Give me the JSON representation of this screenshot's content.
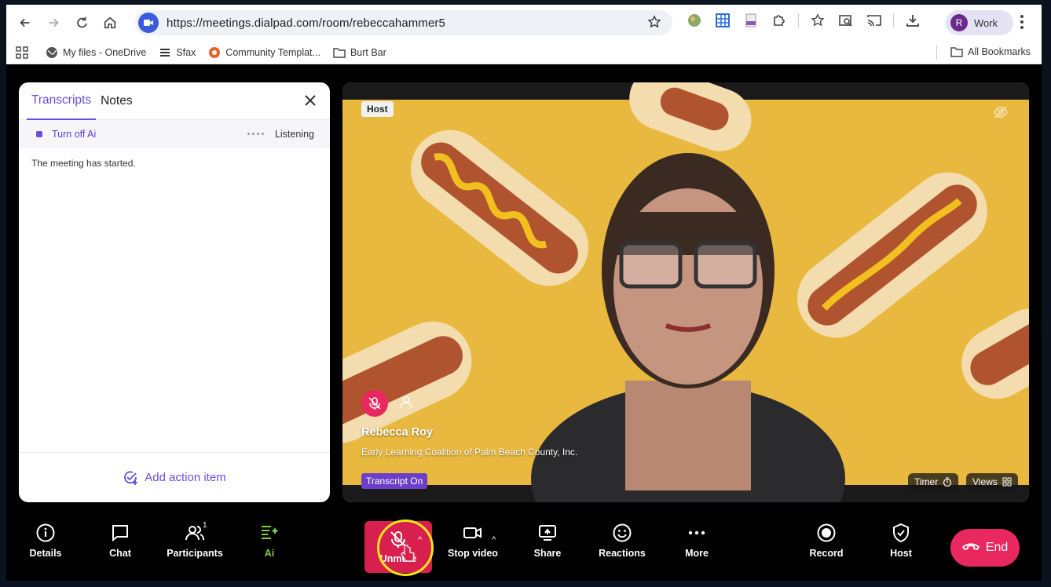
{
  "browser": {
    "url": "https://meetings.dialpad.com/room/rebeccahammer5",
    "profile_initial": "R",
    "profile_label": "Work"
  },
  "bookmarks": {
    "items": [
      "My files - OneDrive",
      "Sfax",
      "Community Templat...",
      "Burt Bar"
    ],
    "all_label": "All Bookmarks"
  },
  "panel": {
    "tabs": [
      "Transcripts",
      "Notes"
    ],
    "ai_toggle_label": "Turn off Ai",
    "status": "Listening",
    "messages": [
      "The meeting has started."
    ],
    "add_action_label": "Add action item"
  },
  "video": {
    "host_badge": "Host",
    "participant_name": "Rebecca Roy",
    "participant_org": "Early Learning Coalition of Palm Beach County, Inc.",
    "transcript_badge": "Transcript On",
    "timer_label": "Timer",
    "views_label": "Views"
  },
  "controls": {
    "details": "Details",
    "chat": "Chat",
    "participants": "Participants",
    "participants_count": "1",
    "ai": "Ai",
    "unmute": "Unmute",
    "stop_video": "Stop video",
    "share": "Share",
    "reactions": "Reactions",
    "more": "More",
    "record": "Record",
    "host": "Host",
    "end": "End"
  },
  "colors": {
    "accent_purple": "#6a4dde",
    "mute_red": "#d8204f",
    "end_pink": "#e8285e",
    "ai_green": "#7ccf3a"
  }
}
